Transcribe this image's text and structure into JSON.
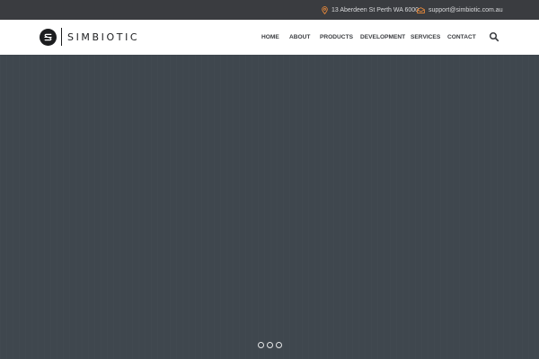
{
  "topbar": {
    "address": "13 Aberdeen St Perth WA 6000",
    "email": "support@simbiotic.com.au",
    "accent_color": "#e8893a"
  },
  "header": {
    "logo_text": "SIMBIOTIC",
    "nav": [
      {
        "label": "HOME"
      },
      {
        "label": "ABOUT"
      },
      {
        "label": "PRODUCTS"
      },
      {
        "label": "DEVELOPMENT"
      },
      {
        "label": "SERVICES"
      },
      {
        "label": "CONTACT"
      }
    ],
    "search_icon": "search-icon"
  },
  "hero": {
    "background_color": "#3f474e",
    "slide_count": 3
  }
}
